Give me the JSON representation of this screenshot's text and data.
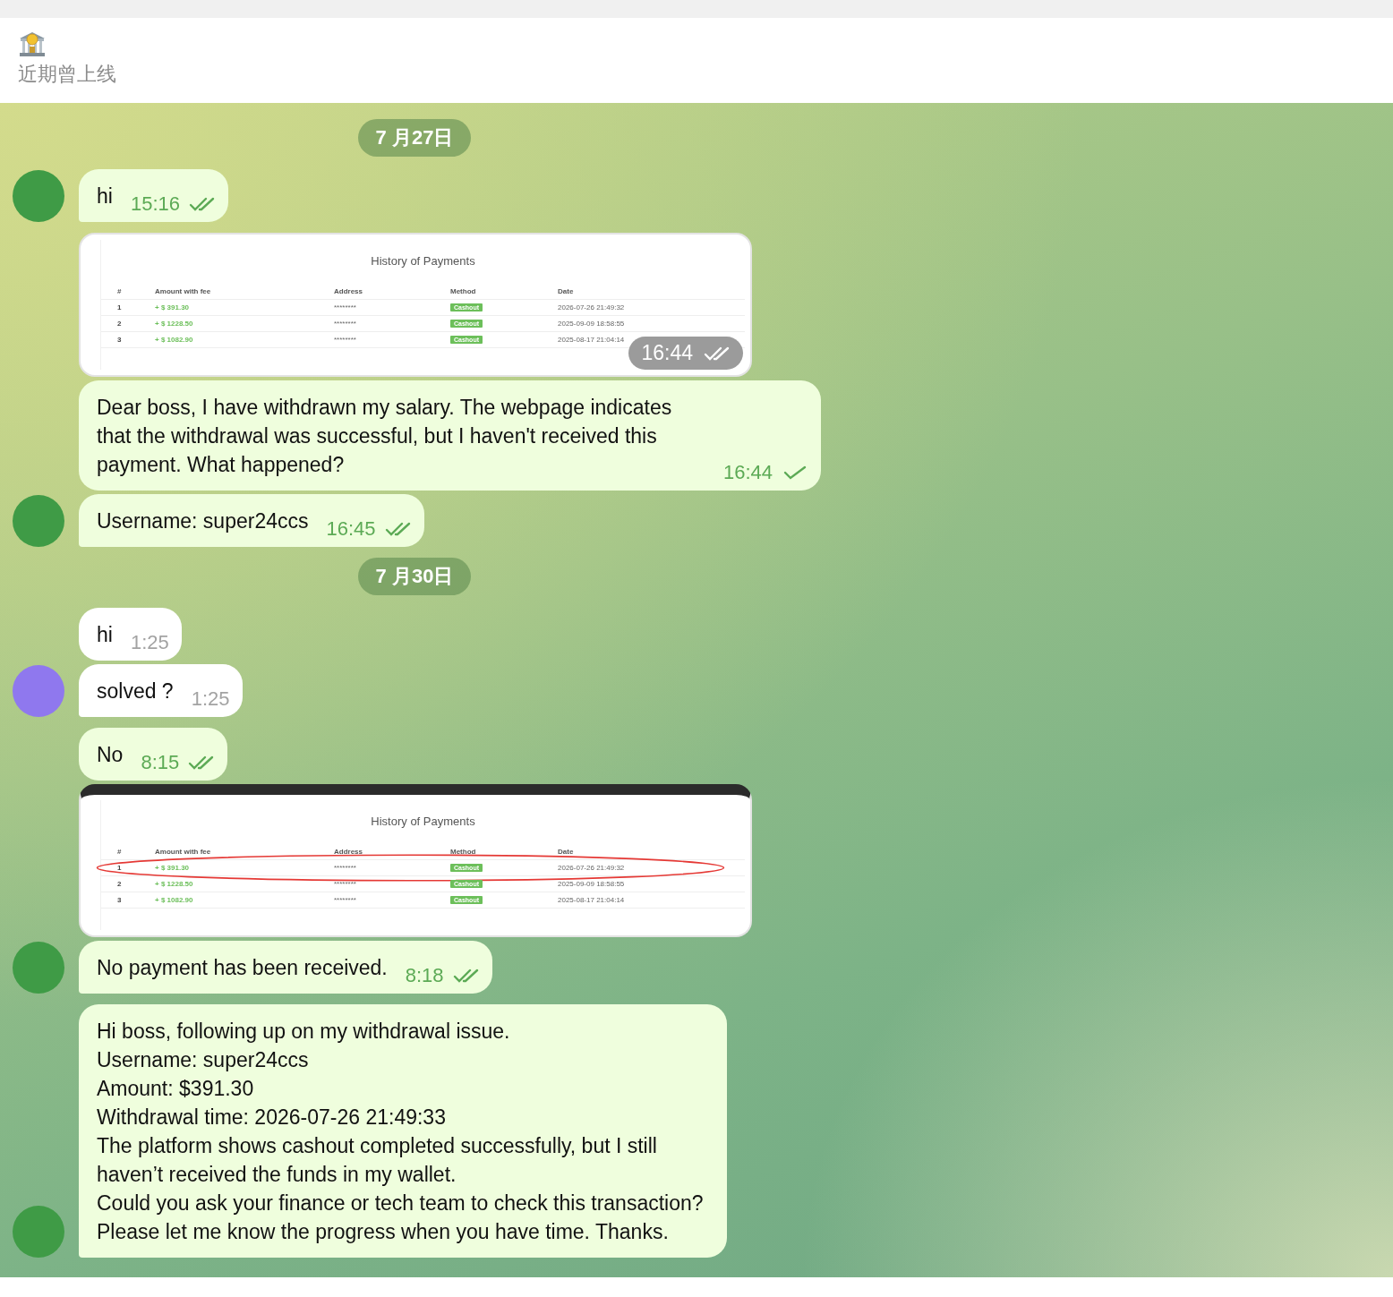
{
  "header": {
    "status": "近期曾上线"
  },
  "chat": [
    {
      "kind": "date",
      "text": "7 月27日"
    },
    {
      "kind": "group",
      "color": "#3f9b46",
      "messages": [
        {
          "kind": "text",
          "outgoing": true,
          "text": "hi",
          "time": "15:16",
          "read": true
        }
      ]
    },
    {
      "kind": "group",
      "color": "#3f9b46",
      "messages": [
        {
          "kind": "screenshot",
          "time": "16:44",
          "read": true,
          "top_bar": false,
          "title": "History of Payments",
          "columns": [
            "#",
            "Amount with fee",
            "Address",
            "Method",
            "Date"
          ],
          "rows": [
            {
              "number": "1",
              "amount": "+ $ 391.30",
              "address": "********",
              "method": "Cashout",
              "date": "2026-07-26 21:49:32",
              "circled": false
            },
            {
              "number": "2",
              "amount": "+ $ 1228.50",
              "address": "********",
              "method": "Cashout",
              "date": "2025-09-09 18:58:55",
              "circled": false
            },
            {
              "number": "3",
              "amount": "+ $ 1082.90",
              "address": "********",
              "method": "Cashout",
              "date": "2025-08-17 21:04:14",
              "circled": false
            }
          ]
        },
        {
          "kind": "text",
          "outgoing": true,
          "text": "Dear boss, I have withdrawn my salary. The webpage indicates that the withdrawal was successful, but I haven't received this payment. What happened?",
          "time": "16:44",
          "read": false
        },
        {
          "kind": "text",
          "outgoing": true,
          "text": "Username: super24ccs",
          "time": "16:45",
          "read": true
        }
      ]
    },
    {
      "kind": "date",
      "text": "7 月30日"
    },
    {
      "kind": "group",
      "color": "#8f78ee",
      "messages": [
        {
          "kind": "text",
          "outgoing": false,
          "text": "hi",
          "time": "1:25"
        },
        {
          "kind": "text",
          "outgoing": false,
          "text": "solved ?",
          "time": "1:25"
        }
      ]
    },
    {
      "kind": "group",
      "color": "#3f9b46",
      "messages": [
        {
          "kind": "text",
          "outgoing": true,
          "text": "No",
          "time": "8:15",
          "read": true
        },
        {
          "kind": "screenshot",
          "top_bar": true,
          "title": "History of Payments",
          "columns": [
            "#",
            "Amount with fee",
            "Address",
            "Method",
            "Date"
          ],
          "rows": [
            {
              "number": "1",
              "amount": "+ $ 391.30",
              "address": "********",
              "method": "Cashout",
              "date": "2026-07-26 21:49:32",
              "circled": true
            },
            {
              "number": "2",
              "amount": "+ $ 1228.50",
              "address": "********",
              "method": "Cashout",
              "date": "2025-09-09 18:58:55",
              "circled": false
            },
            {
              "number": "3",
              "amount": "+ $ 1082.90",
              "address": "********",
              "method": "Cashout",
              "date": "2025-08-17 21:04:14",
              "circled": false
            }
          ]
        },
        {
          "kind": "text",
          "outgoing": true,
          "text": "No payment has been received.",
          "time": "8:18",
          "read": true
        }
      ]
    },
    {
      "kind": "group",
      "color": "#3f9b46",
      "messages": [
        {
          "kind": "text",
          "outgoing": true,
          "text": "Hi boss, following up on my withdrawal issue.\nUsername: super24ccs\nAmount: $391.30\nWithdrawal time: 2026-07-26 21:49:33\nThe platform shows cashout completed successfully, but I still haven’t received the funds in my wallet.\nCould you ask your finance or tech team to check this transaction?\nPlease let me know the progress when you have time. Thanks."
        }
      ]
    }
  ]
}
